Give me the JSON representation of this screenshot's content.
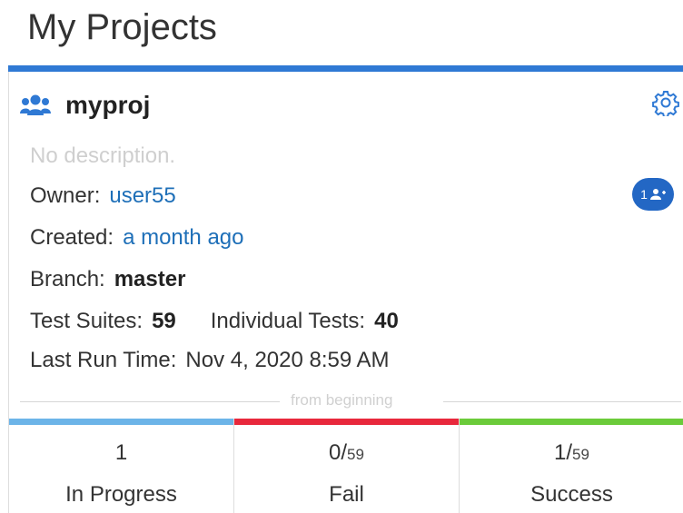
{
  "page": {
    "title": "My Projects"
  },
  "project": {
    "name": "myproj",
    "description": "No description.",
    "owner_label": "Owner:",
    "owner": "user55",
    "created_label": "Created:",
    "created": "a month ago",
    "branch_label": "Branch:",
    "branch": "master",
    "suites_label": "Test Suites:",
    "suites": "59",
    "individual_label": "Individual Tests:",
    "individual": "40",
    "last_run_label": "Last Run Time:",
    "last_run": "Nov 4, 2020 8:59 AM",
    "members_count": "1",
    "accent_color": "#2f79d4"
  },
  "divider": {
    "label": "from beginning"
  },
  "stats": [
    {
      "value": "1",
      "total": "",
      "label": "In Progress",
      "color": "#6cb4e8"
    },
    {
      "value": "0/",
      "total": "59",
      "label": "Fail",
      "color": "#e8283c"
    },
    {
      "value": "1/",
      "total": "59",
      "label": "Success",
      "color": "#6bcb3a"
    }
  ],
  "icons": {
    "header": "users-icon",
    "settings": "gear-icon",
    "members": "user-add-icon"
  }
}
